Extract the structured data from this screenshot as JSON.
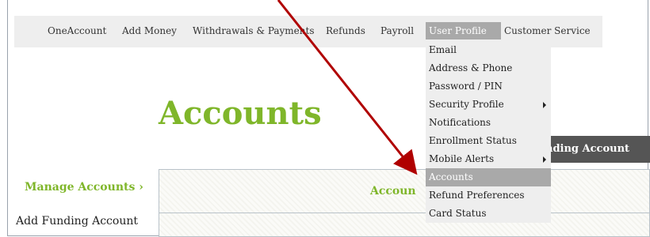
{
  "nav": {
    "items": [
      "OneAccount",
      "Add Money",
      "Withdrawals & Payments",
      "Refunds",
      "Payroll",
      "User Profile",
      "Customer Service"
    ],
    "active": "User Profile"
  },
  "dropdown": {
    "items": [
      {
        "label": "Email",
        "submenu": false,
        "highlighted": false
      },
      {
        "label": "Address & Phone",
        "submenu": false,
        "highlighted": false
      },
      {
        "label": "Password / PIN",
        "submenu": false,
        "highlighted": false
      },
      {
        "label": "Security Profile",
        "submenu": true,
        "highlighted": false
      },
      {
        "label": "Notifications",
        "submenu": false,
        "highlighted": false
      },
      {
        "label": "Enrollment Status",
        "submenu": false,
        "highlighted": false
      },
      {
        "label": "Mobile Alerts",
        "submenu": true,
        "highlighted": false
      },
      {
        "label": "Accounts",
        "submenu": false,
        "highlighted": true
      },
      {
        "label": "Refund Preferences",
        "submenu": false,
        "highlighted": false
      },
      {
        "label": "Card Status",
        "submenu": false,
        "highlighted": false
      }
    ]
  },
  "page": {
    "title": "Accounts",
    "funding_button": "nding Account",
    "manage_link": "Manage Accounts ›",
    "add_funding": "Add Funding Account",
    "panel_header": "Accoun"
  },
  "colors": {
    "accent_green": "#7fb62a",
    "active_gray": "#a9a9a9",
    "nav_bg": "#eeeeee",
    "button_dark": "#555555",
    "annotation_red": "#b00000"
  }
}
